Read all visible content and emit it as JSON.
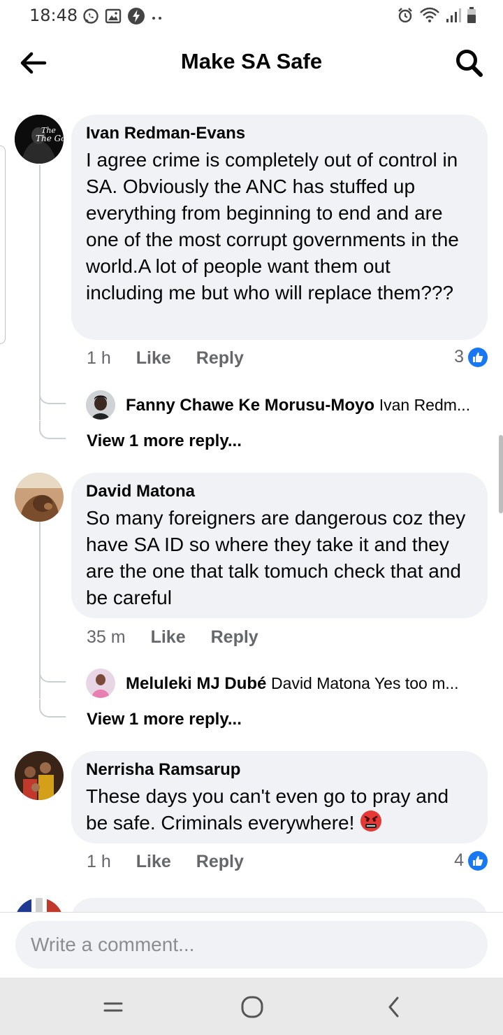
{
  "status_bar": {
    "time": "18:48",
    "left_icons": [
      "whatsapp-icon",
      "gallery-icon",
      "bolt-icon",
      "more-dots-icon"
    ],
    "right_icons": [
      "alarm-icon",
      "wifi-icon",
      "signal-icon",
      "battery-icon"
    ]
  },
  "header": {
    "title": "Make SA Safe",
    "back_icon": "back-arrow-icon",
    "search_icon": "search-icon"
  },
  "colors": {
    "accent": "#1877f2",
    "bubble": "#f0f2f5",
    "meta_text": "#65676b",
    "thread_line": "#ccd0d5"
  },
  "comments": [
    {
      "author": "Ivan Redman-Evans",
      "avatar_text": "The Godfather",
      "text": "I agree crime is completely out of control in SA. Obviously the ANC has stuffed up everything from beginning to end and are one of the most corrupt governments in the world.A lot of people want them out including me but who will replace them???",
      "time": "1 h",
      "like_label": "Like",
      "reply_label": "Reply",
      "reaction_count": "3",
      "reply_preview": {
        "name": "Fanny Chawe Ke Morusu-Moyo",
        "text": "Ivan Redm..."
      },
      "more_replies": "View 1 more reply..."
    },
    {
      "author": "David Matona",
      "text": "So many foreigners are dangerous coz they have SA ID so where they take it and they are the one that talk tomuch check that and be careful",
      "time": "35 m",
      "like_label": "Like",
      "reply_label": "Reply",
      "reply_preview": {
        "name": "Meluleki MJ Dubé",
        "text": "David Matona Yes too m..."
      },
      "more_replies": "View 1 more reply..."
    },
    {
      "author": "Nerrisha Ramsarup",
      "text": "These days you can't even go to pray and be safe. Criminals everywhere!",
      "emoji": "angry-face-emoji",
      "time": "1 h",
      "like_label": "Like",
      "reply_label": "Reply",
      "reaction_count": "4"
    }
  ],
  "composer": {
    "placeholder": "Write a comment...",
    "value": ""
  },
  "nav_bar": {
    "icons": [
      "recent-apps-icon",
      "home-icon",
      "back-icon"
    ]
  }
}
